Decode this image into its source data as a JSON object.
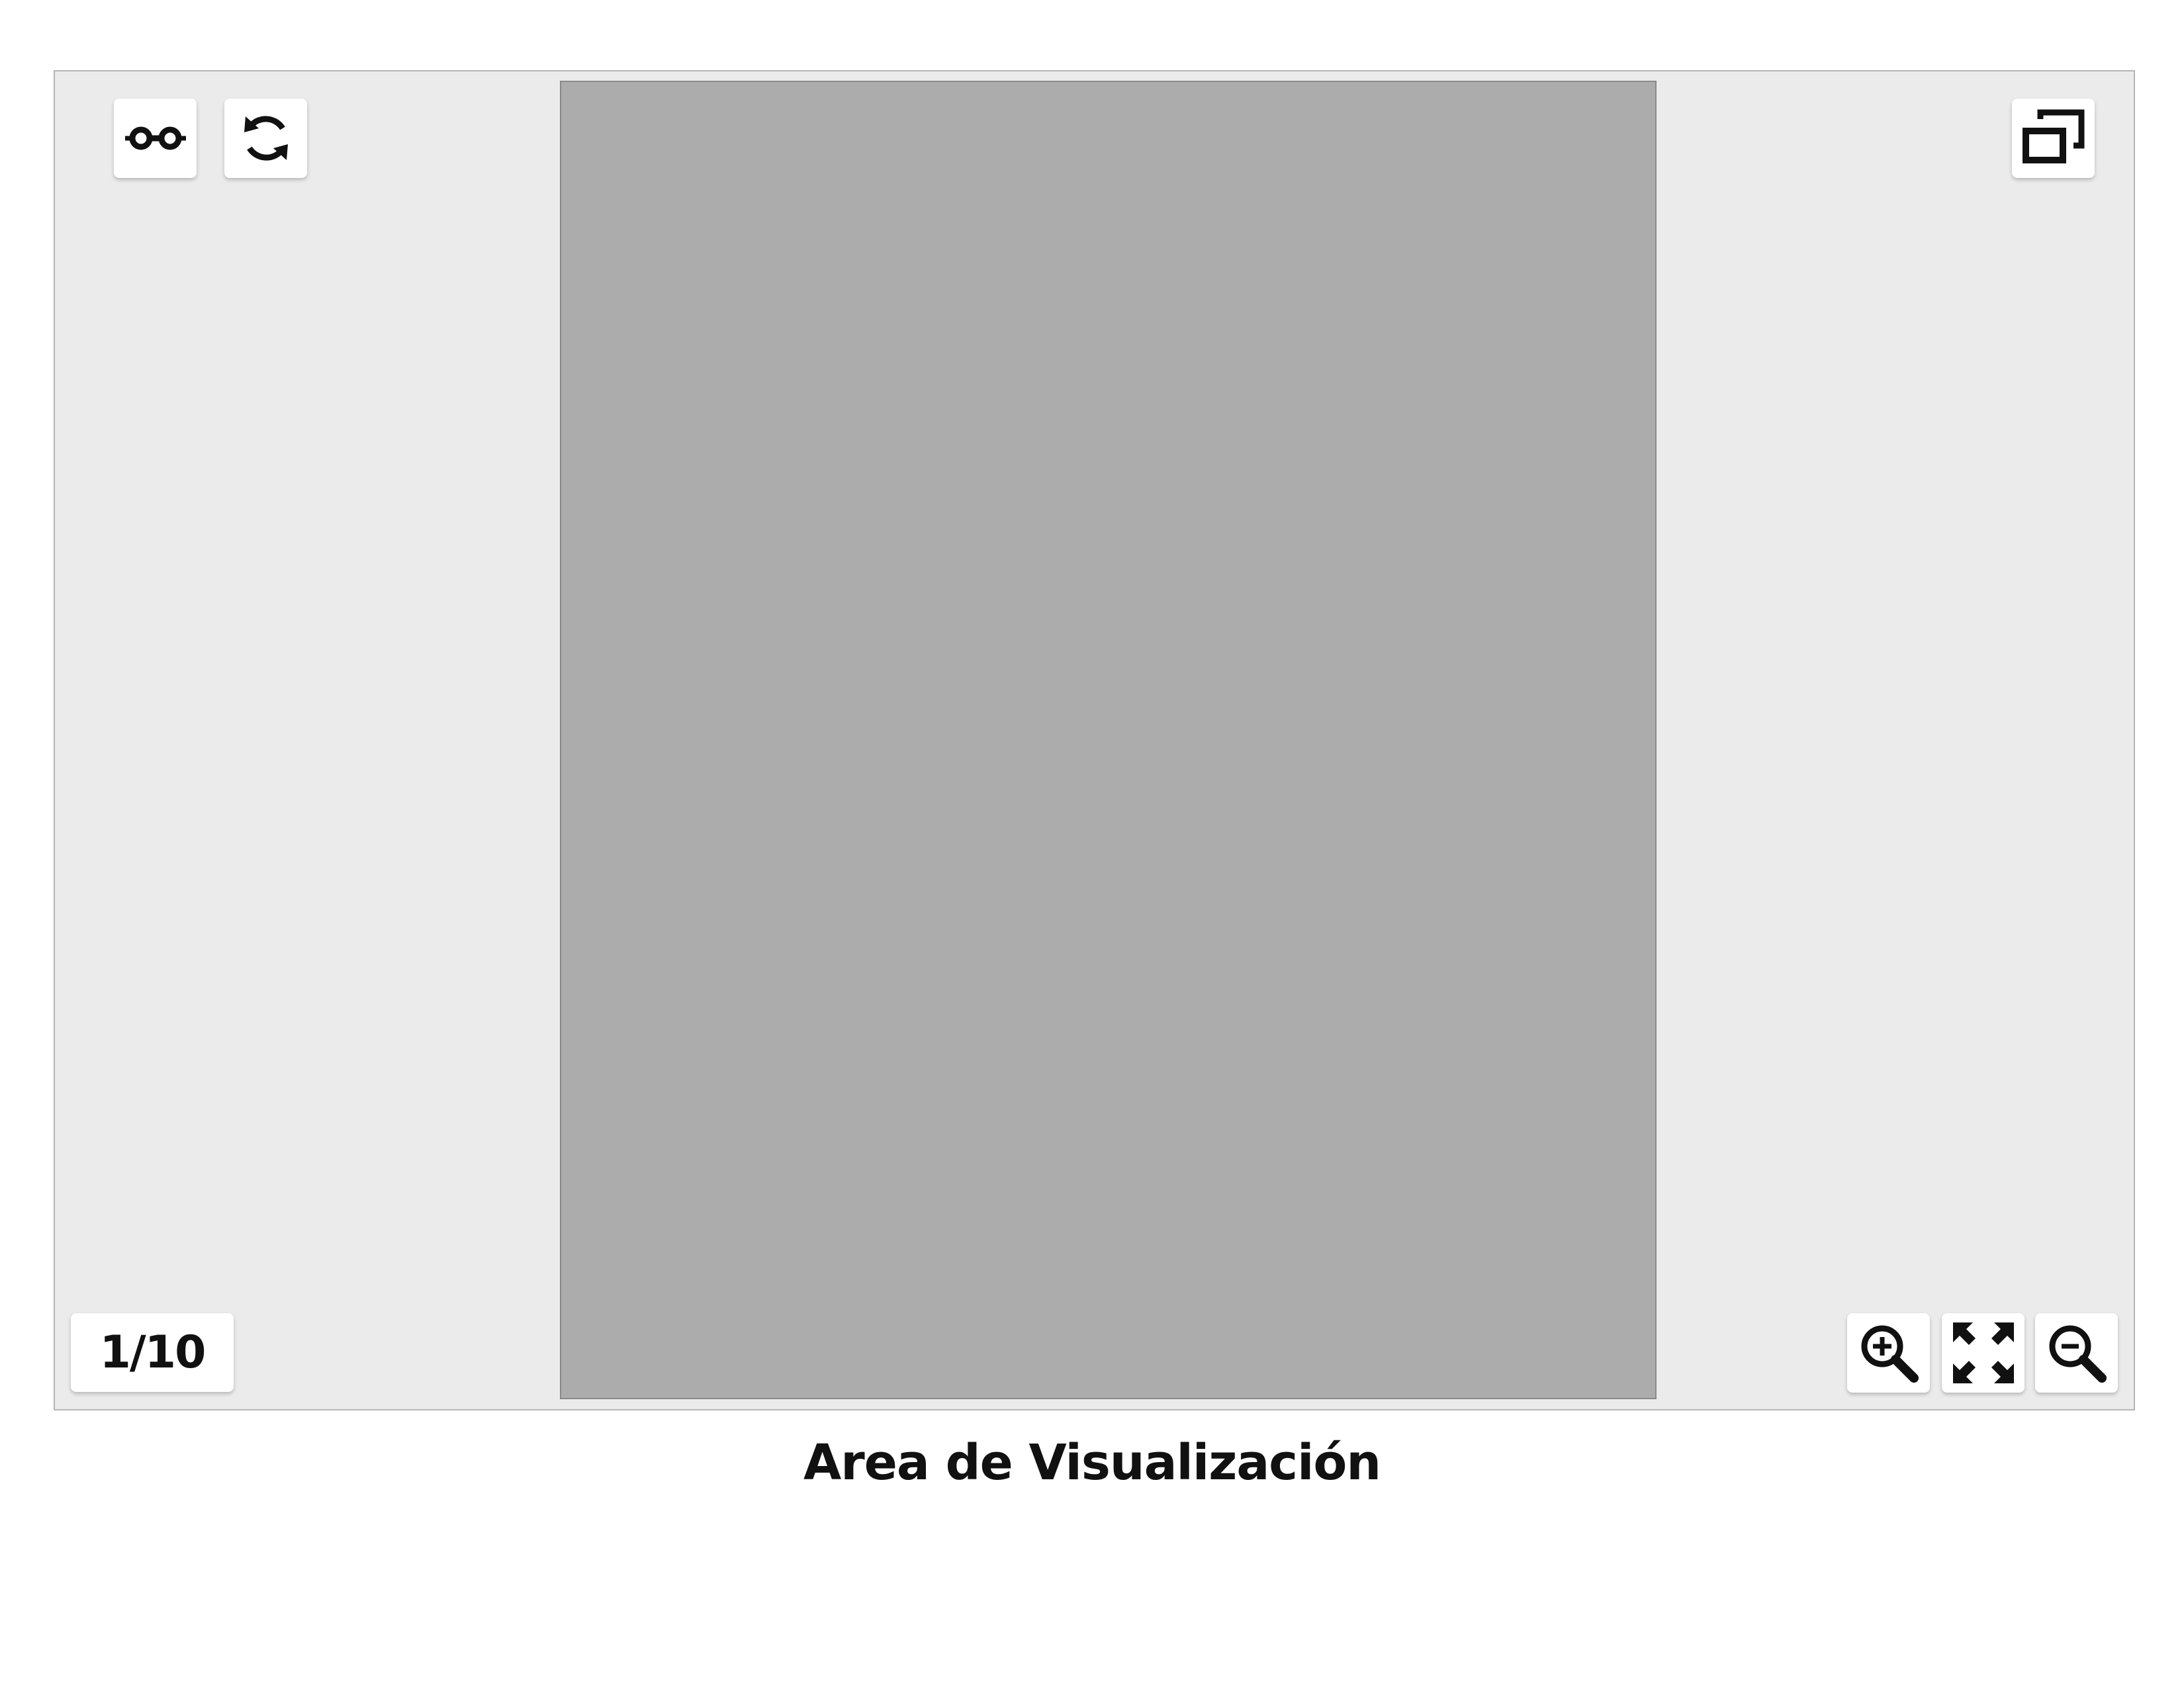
{
  "viewer": {
    "toolbar_top_left": [
      {
        "name": "glasses-icon",
        "action": "reading-mode"
      },
      {
        "name": "refresh-icon",
        "action": "reload"
      }
    ],
    "toolbar_top_right": [
      {
        "name": "window-restore-icon",
        "action": "restore-window"
      }
    ],
    "toolbar_bottom_right": [
      {
        "name": "zoom-in-icon",
        "action": "zoom-in"
      },
      {
        "name": "expand-icon",
        "action": "fit-to-screen"
      },
      {
        "name": "zoom-out-icon",
        "action": "zoom-out"
      }
    ],
    "page_counter": "1/10"
  },
  "caption": "Area de Visualización",
  "colors": {
    "viewer_background": "#ebebeb",
    "viewer_border": "#b5b5b5",
    "canvas_fill": "#acacac",
    "icon_color": "#111111",
    "button_background": "#ffffff"
  }
}
